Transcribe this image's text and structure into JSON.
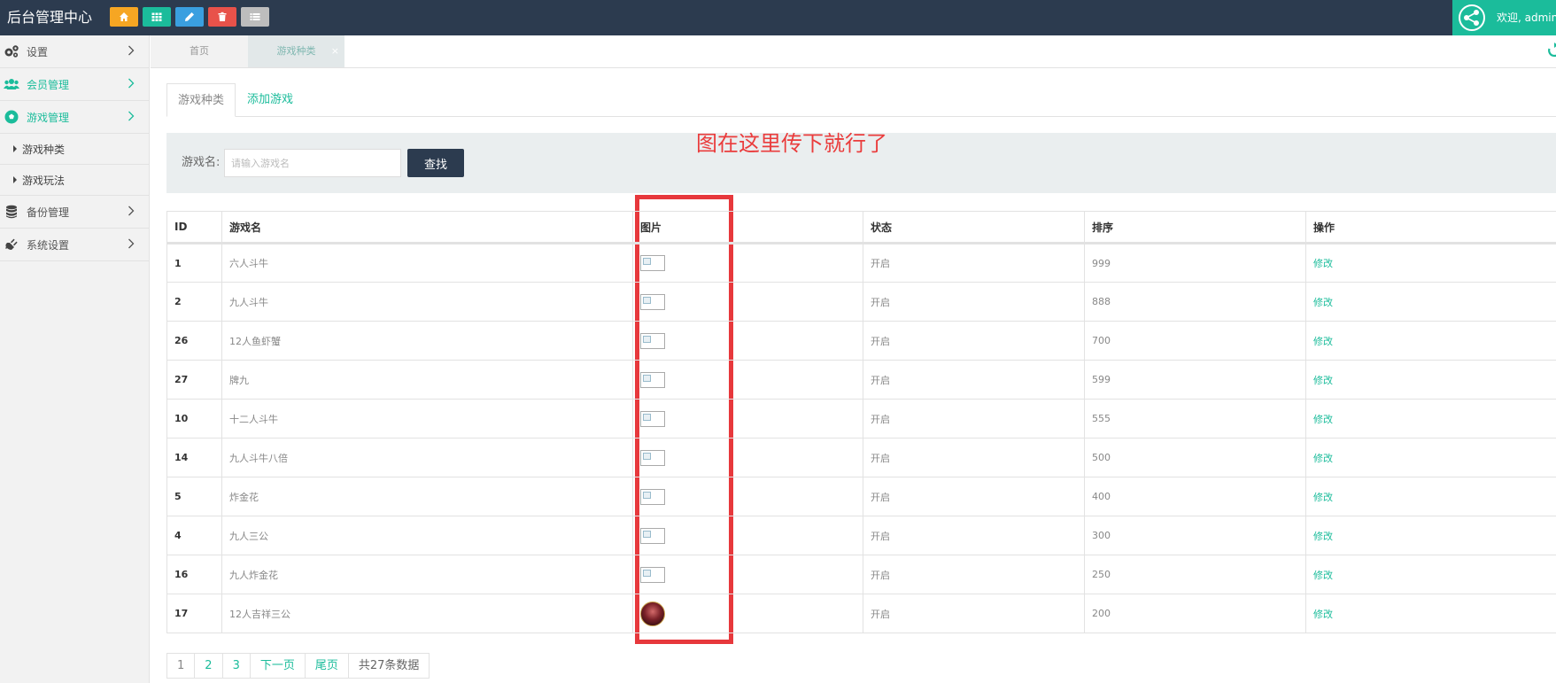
{
  "app": {
    "title": "后台管理中心"
  },
  "quick_buttons": [
    {
      "icon": "home-icon",
      "color": "#f6a623"
    },
    {
      "icon": "grid-icon",
      "color": "#1bbc9b"
    },
    {
      "icon": "pencil-icon",
      "color": "#3a9fe0"
    },
    {
      "icon": "trash-icon",
      "color": "#e8524a"
    },
    {
      "icon": "list-icon",
      "color": "#bdbdbd"
    }
  ],
  "user": {
    "greeting": "欢迎, admin"
  },
  "sidebar": {
    "items": [
      {
        "label": "设置",
        "icon": "gears-icon"
      },
      {
        "label": "会员管理",
        "icon": "users-icon"
      },
      {
        "label": "游戏管理",
        "icon": "soccer-ball-icon"
      },
      {
        "label": "备份管理",
        "icon": "database-icon"
      },
      {
        "label": "系统设置",
        "icon": "plug-icon"
      }
    ],
    "sub_items": [
      {
        "label": "游戏种类"
      },
      {
        "label": "游戏玩法"
      }
    ]
  },
  "page_tabs": {
    "home": "首页",
    "current": "游戏种类",
    "close": "×"
  },
  "content_tabs": {
    "active": "游戏种类",
    "other": "添加游戏"
  },
  "search": {
    "label": "游戏名:",
    "placeholder": "请输入游戏名",
    "button": "查找"
  },
  "annotation": {
    "text": "图在这里传下就行了",
    "color": "#e7383c"
  },
  "table": {
    "columns": [
      "ID",
      "游戏名",
      "图片",
      "状态",
      "排序",
      "操作"
    ],
    "rows": [
      {
        "id": "1",
        "name": "六人斗牛",
        "status": "开启",
        "sort": "999",
        "action": "修改"
      },
      {
        "id": "2",
        "name": "九人斗牛",
        "status": "开启",
        "sort": "888",
        "action": "修改"
      },
      {
        "id": "26",
        "name": "12人鱼虾蟹",
        "status": "开启",
        "sort": "700",
        "action": "修改"
      },
      {
        "id": "27",
        "name": "牌九",
        "status": "开启",
        "sort": "599",
        "action": "修改"
      },
      {
        "id": "10",
        "name": "十二人斗牛",
        "status": "开启",
        "sort": "555",
        "action": "修改"
      },
      {
        "id": "14",
        "name": "九人斗牛八倍",
        "status": "开启",
        "sort": "500",
        "action": "修改"
      },
      {
        "id": "5",
        "name": "炸金花",
        "status": "开启",
        "sort": "400",
        "action": "修改"
      },
      {
        "id": "4",
        "name": "九人三公",
        "status": "开启",
        "sort": "300",
        "action": "修改"
      },
      {
        "id": "16",
        "name": "九人炸金花",
        "status": "开启",
        "sort": "250",
        "action": "修改"
      },
      {
        "id": "17",
        "name": "12人吉祥三公",
        "status": "开启",
        "sort": "200",
        "action": "修改"
      }
    ]
  },
  "pagination": {
    "pages": [
      "1",
      "2",
      "3"
    ],
    "next": "下一页",
    "last": "尾页",
    "total": "共27条数据"
  },
  "colors": {
    "accent": "#1bbc9b",
    "topbar": "#2c3b4f"
  }
}
